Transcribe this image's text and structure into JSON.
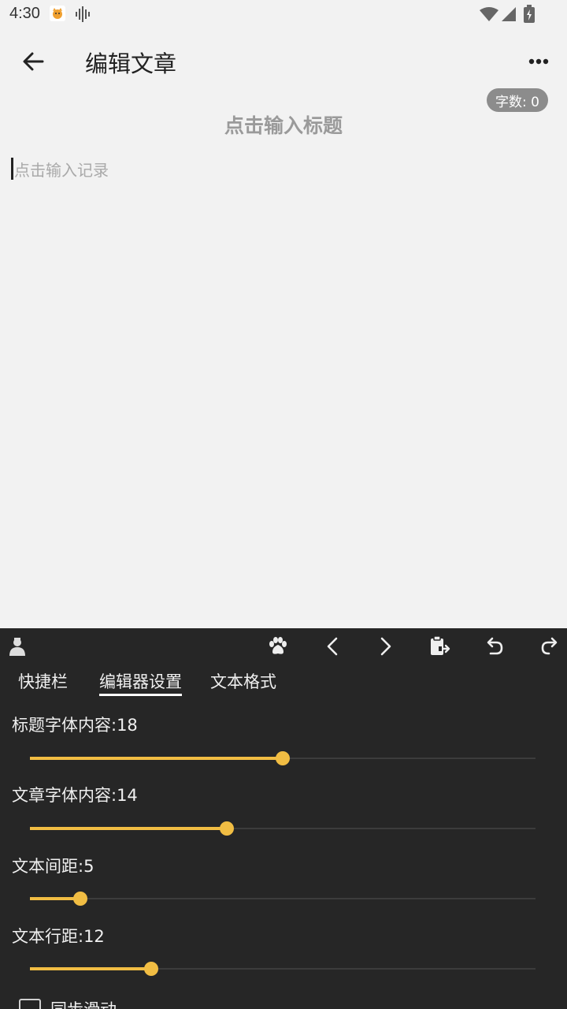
{
  "status_bar": {
    "time": "4:30"
  },
  "app_bar": {
    "title": "编辑文章"
  },
  "editor": {
    "word_count": "字数: 0",
    "title_placeholder": "点击输入标题",
    "body_placeholder": "点击输入记录"
  },
  "tabs": [
    {
      "label": "快捷栏"
    },
    {
      "label": "编辑器设置"
    },
    {
      "label": "文本格式"
    }
  ],
  "active_tab": "编辑器设置",
  "settings": [
    {
      "label": "标题字体内容:18",
      "position": 0.5
    },
    {
      "label": "文章字体内容:14",
      "position": 0.39
    },
    {
      "label": "文本间距:5",
      "position": 0.1
    },
    {
      "label": "文本行距:12",
      "position": 0.24
    }
  ],
  "sync_scroll": {
    "label": "同步滑动",
    "checked": false
  },
  "icons": {
    "toolbar": [
      "user-avatar-icon",
      "paw-icon",
      "chevron-left-icon",
      "chevron-right-icon",
      "clipboard-export-icon",
      "undo-icon",
      "redo-icon"
    ]
  },
  "colors": {
    "accent": "#f1bd43",
    "panel": "#262626",
    "background": "#f2f2f2"
  }
}
